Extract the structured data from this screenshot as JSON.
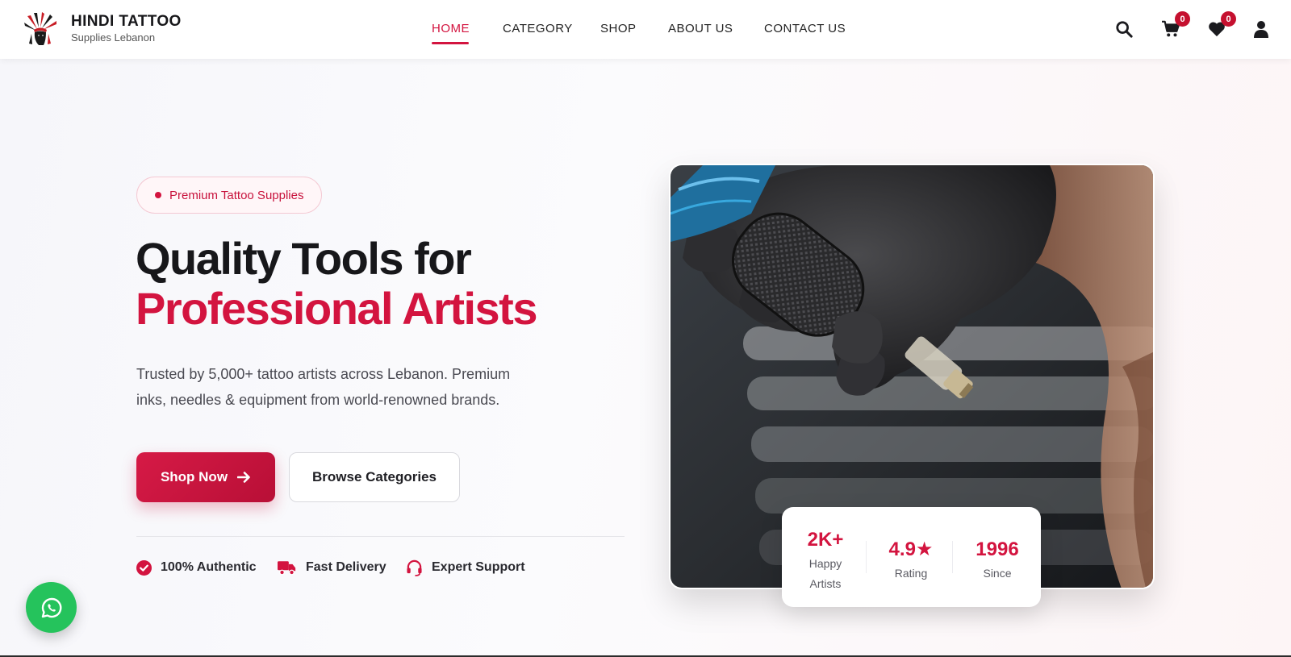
{
  "brand": {
    "name": "HINDI TATTOO",
    "subtitle": "Supplies Lebanon",
    "logo_icon": "native-headdress-logo-icon"
  },
  "nav": {
    "items": [
      {
        "label": "HOME",
        "active": true
      },
      {
        "label": "CATEGORY",
        "active": false
      },
      {
        "label": "SHOP",
        "active": false
      },
      {
        "label": "ABOUT US",
        "active": false
      },
      {
        "label": "CONTACT US",
        "active": false
      }
    ]
  },
  "header_actions": {
    "search_icon": "search-icon",
    "cart": {
      "icon": "cart-icon",
      "count": "0"
    },
    "wishlist": {
      "icon": "heart-icon",
      "count": "0"
    },
    "account_icon": "user-icon"
  },
  "hero": {
    "badge": "Premium Tattoo Supplies",
    "headline_line1": "Quality Tools for",
    "headline_line2": "Professional Artists",
    "description": "Trusted by 5,000+ tattoo artists across Lebanon. Premium inks, needles & equipment from world-renowned brands.",
    "primary_button": "Shop Now",
    "secondary_button": "Browse Categories",
    "features": [
      {
        "label": "100% Authentic",
        "icon": "check-circle-icon"
      },
      {
        "label": "Fast Delivery",
        "icon": "truck-icon"
      },
      {
        "label": "Expert Support",
        "icon": "headset-icon"
      }
    ]
  },
  "stats": [
    {
      "value": "2K+",
      "label": "Happy Artists"
    },
    {
      "value": "4.9★",
      "label": "Rating"
    },
    {
      "value": "1996",
      "label": "Since"
    }
  ],
  "colors": {
    "accent": "#d3143f",
    "accent_dark": "#b80f36",
    "text": "#17171a",
    "whatsapp": "#25c35c"
  },
  "floating": {
    "whatsapp_icon": "whatsapp-icon"
  }
}
